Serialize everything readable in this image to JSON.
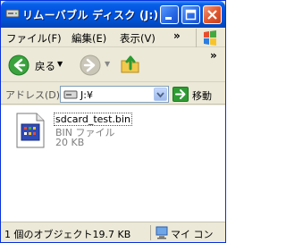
{
  "window": {
    "title": "リムーバブル ディスク (J:)"
  },
  "menu": {
    "items": [
      "ファイル(F)",
      "編集(E)",
      "表示(V)"
    ],
    "overflow": "»"
  },
  "toolbar": {
    "back_label": "戻る",
    "overflow": "»"
  },
  "address": {
    "label": "アドレス(D)",
    "value": "J:¥",
    "go_label": "移動"
  },
  "file": {
    "name": "sdcard_test.bin",
    "type": "BIN ファイル",
    "size": "20 KB"
  },
  "status": {
    "info": "1 個のオブジェクト",
    "size": "19.7 KB",
    "zone": "マイ コン"
  },
  "colors": {
    "titlebar": "#0053e0",
    "window_bg": "#ece9d8",
    "content_bg": "#ffffff"
  }
}
